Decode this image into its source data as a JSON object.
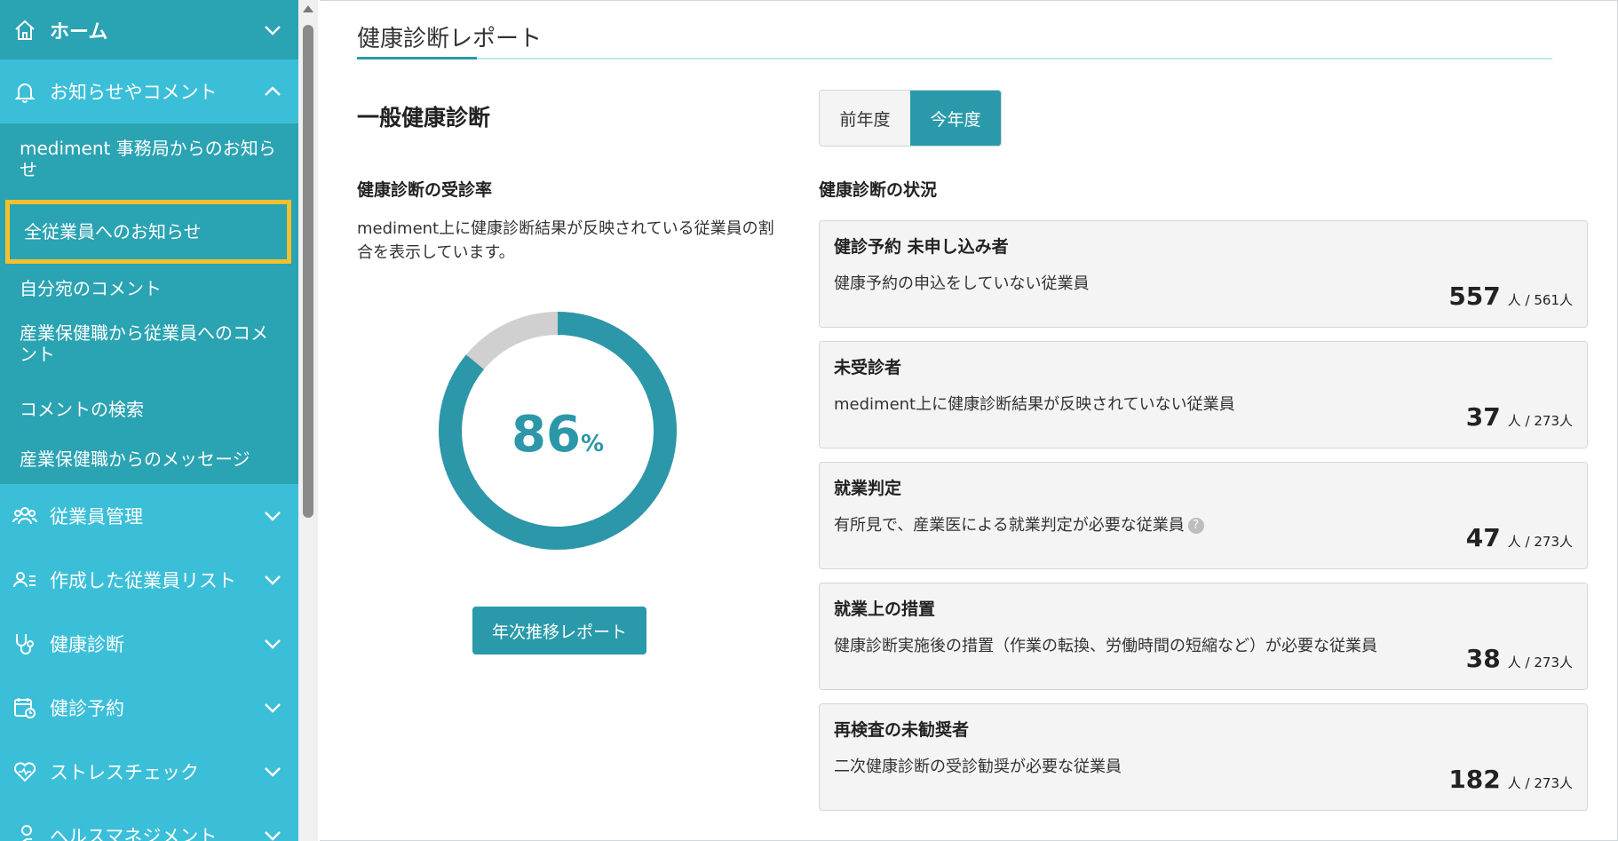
{
  "sidebar": {
    "home": "ホーム",
    "notices": {
      "label": "お知らせやコメント",
      "items": [
        "mediment 事務局からのお知らせ",
        "全従業員へのお知らせ",
        "自分宛のコメント",
        "産業保健職から従業員へのコメント",
        "コメントの検索",
        "産業保健職からのメッセージ"
      ]
    },
    "sections": [
      "従業員管理",
      "作成した従業員リスト",
      "健康診断",
      "健診予約",
      "ストレスチェック",
      "ヘルスマネジメント"
    ]
  },
  "main": {
    "page_title": "健康診断レポート",
    "section_title": "一般健康診断",
    "year_toggle": {
      "previous": "前年度",
      "current": "今年度",
      "selected": "current"
    },
    "rate": {
      "heading": "健康診断の受診率",
      "description": "mediment上に健康診断結果が反映されている従業員の割合を表示しています。",
      "value": "86",
      "unit": "%",
      "fraction": 0.86,
      "colors": {
        "filled": "#2c97a8",
        "remaining": "#d0d0d0"
      }
    },
    "annual_report_button": "年次推移レポート",
    "status": {
      "heading": "健康診断の状況",
      "cards": [
        {
          "title": "健診予約 未申し込み者",
          "description": "健康予約の申込をしていない従業員",
          "count": "557",
          "total": "人 / 561人",
          "help": false
        },
        {
          "title": "未受診者",
          "description": "mediment上に健康診断結果が反映されていない従業員",
          "count": "37",
          "total": "人 / 273人",
          "help": false
        },
        {
          "title": "就業判定",
          "description": "有所見で、産業医による就業判定が必要な従業員",
          "count": "47",
          "total": "人 / 273人",
          "help": true
        },
        {
          "title": "就業上の措置",
          "description": "健康診断実施後の措置（作業の転換、労働時間の短縮など）が必要な従業員",
          "count": "38",
          "total": "人 / 273人",
          "help": false
        },
        {
          "title": "再検査の未勧奨者",
          "description": "二次健康診断の受診勧奨が必要な従業員",
          "count": "182",
          "total": "人 / 273人",
          "help": false
        }
      ]
    }
  },
  "theme": {
    "sidebar_bg": "#3bbfd9",
    "sidebar_dark": "#2aa3b3",
    "accent": "#2a9aaa",
    "highlight": "#f5c02b"
  }
}
